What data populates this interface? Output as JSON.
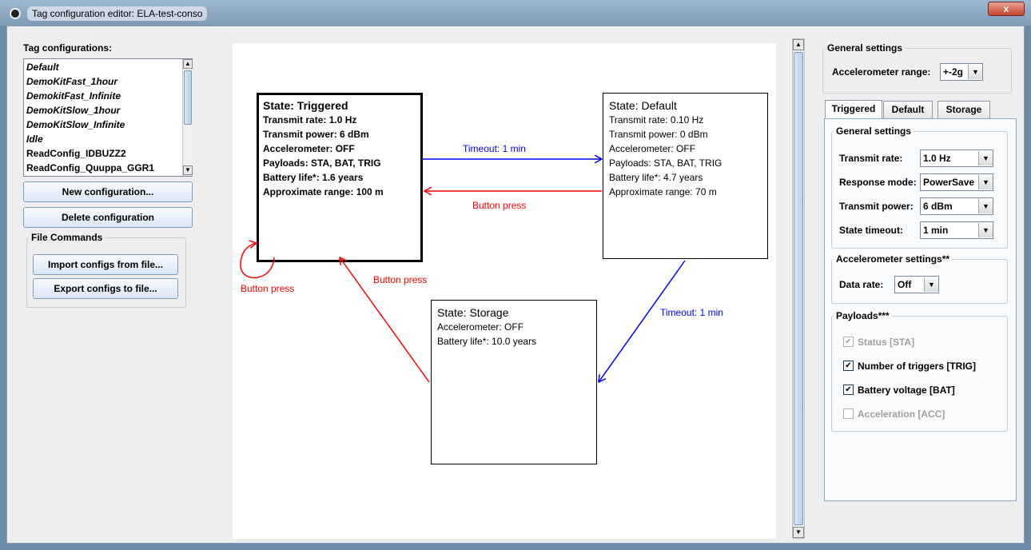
{
  "window": {
    "title": "Tag configuration editor:  ELA-test-conso",
    "close_label": "x"
  },
  "left_panel": {
    "heading": "Tag configurations:",
    "configs": [
      {
        "label": "Default",
        "italic": true
      },
      {
        "label": "DemoKitFast_1hour",
        "italic": true
      },
      {
        "label": "DemokitFast_Infinite",
        "italic": true
      },
      {
        "label": "DemoKitSlow_1hour",
        "italic": true
      },
      {
        "label": "DemoKitSlow_Infinite",
        "italic": true
      },
      {
        "label": "Idle",
        "italic": true
      },
      {
        "label": "ReadConfig_IDBUZZ2",
        "italic": false
      },
      {
        "label": "ReadConfig_Quuppa_GGR1",
        "italic": false
      }
    ],
    "new_button": "New configuration...",
    "delete_button": "Delete configuration",
    "file_commands": {
      "title": "File Commands",
      "import_button": "Import configs from file...",
      "export_button": "Export configs to file..."
    }
  },
  "diagram": {
    "states": {
      "triggered": {
        "title": "State: Triggered",
        "lines": [
          "Transmit rate: 1.0 Hz",
          "Transmit power: 6 dBm",
          "Accelerometer: OFF",
          "Payloads: STA, BAT, TRIG",
          "Battery life*: 1.6 years",
          "Approximate range: 100 m"
        ]
      },
      "default": {
        "title": "State: Default",
        "lines": [
          "Transmit rate: 0.10 Hz",
          "Transmit power: 0 dBm",
          "Accelerometer: OFF",
          "Payloads: STA, BAT, TRIG",
          "Battery life*: 4.7 years",
          "Approximate range: 70 m"
        ]
      },
      "storage": {
        "title": "State: Storage",
        "lines": [
          "Accelerometer: OFF",
          "Battery life*: 10.0 years"
        ]
      }
    },
    "transitions": {
      "triggered_to_default": "Timeout: 1 min",
      "default_to_triggered": "Button press",
      "triggered_self": "Button press",
      "storage_to_triggered": "Button press",
      "default_to_storage": "Timeout: 1 min"
    },
    "colors": {
      "timeout": "#0000ff",
      "button": "#ff0000"
    }
  },
  "right_panel": {
    "general": {
      "title": "General settings",
      "accel_range_label": "Accelerometer range:",
      "accel_range_value": "+-2g"
    },
    "tabs": [
      "Triggered",
      "Default",
      "Storage"
    ],
    "active_tab": "Triggered",
    "state_general": {
      "title": "General settings",
      "transmit_rate_label": "Transmit rate:",
      "transmit_rate_value": "1.0 Hz",
      "response_mode_label": "Response mode:",
      "response_mode_value": "PowerSave",
      "transmit_power_label": "Transmit power:",
      "transmit_power_value": "6 dBm",
      "state_timeout_label": "State timeout:",
      "state_timeout_value": "1 min"
    },
    "accelerometer": {
      "title": "Accelerometer settings**",
      "data_rate_label": "Data rate:",
      "data_rate_value": "Off"
    },
    "payloads": {
      "title": "Payloads***",
      "items": [
        {
          "label": "Status [STA]",
          "checked": true,
          "enabled": false
        },
        {
          "label": "Number of triggers [TRIG]",
          "checked": true,
          "enabled": true
        },
        {
          "label": "Battery voltage [BAT]",
          "checked": true,
          "enabled": true
        },
        {
          "label": "Acceleration [ACC]",
          "checked": false,
          "enabled": false
        }
      ]
    }
  }
}
